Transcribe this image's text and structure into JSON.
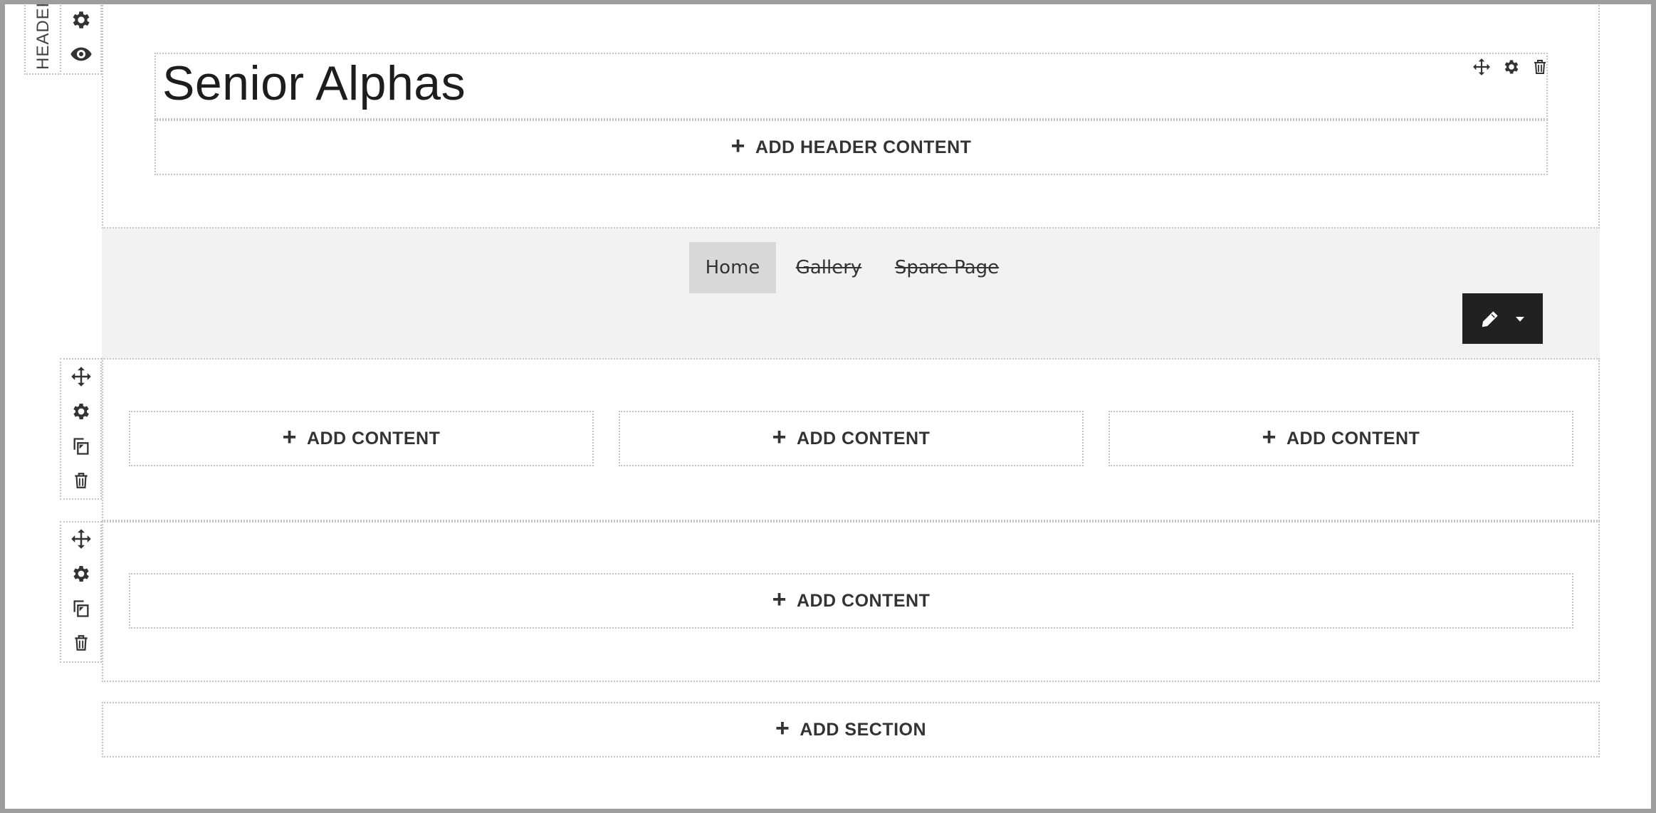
{
  "header": {
    "vertical_label": "HEADER",
    "title": "Senior Alphas",
    "add_header_content": "ADD HEADER CONTENT"
  },
  "nav": {
    "items": [
      {
        "label": "Home",
        "active": true
      },
      {
        "label": "Gallery",
        "hidden": true
      },
      {
        "label": "Spare Page",
        "hidden": true
      }
    ]
  },
  "row1": {
    "columns": [
      {
        "label": "ADD CONTENT"
      },
      {
        "label": "ADD CONTENT"
      },
      {
        "label": "ADD CONTENT"
      }
    ]
  },
  "row2": {
    "columns": [
      {
        "label": "ADD CONTENT"
      }
    ]
  },
  "add_section": "ADD SECTION",
  "icons": {
    "gear": "gear-icon",
    "eye": "eye-icon",
    "move": "move-icon",
    "copy": "copy-icon",
    "trash": "trash-icon",
    "pencil": "pencil-icon",
    "caret": "caret-down-icon",
    "plus": "plus-icon"
  },
  "colors": {
    "edit_button_bg": "#212121",
    "nav_band_bg": "#f2f2f2",
    "nav_active_bg": "#d9d9d9",
    "dotted_border": "#c4c4c4"
  }
}
